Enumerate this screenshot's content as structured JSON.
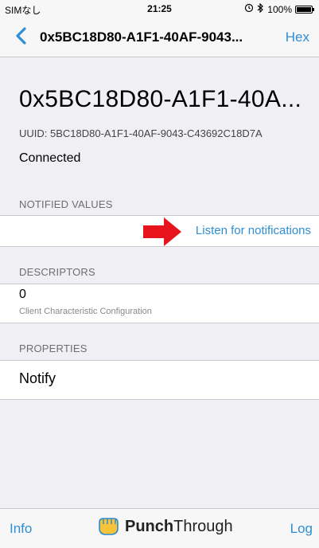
{
  "status": {
    "carrier": "SIMなし",
    "time": "21:25",
    "battery": "100%",
    "battery_level": 1.0
  },
  "nav": {
    "title": "0x5BC18D80-A1F1-40AF-9043...",
    "hex_label": "Hex",
    "back_icon": "chevron-left-icon"
  },
  "header": {
    "title": "0x5BC18D80-A1F1-40A...",
    "uuid": "UUID: 5BC18D80-A1F1-40AF-9043-C43692C18D7A",
    "state": "Connected"
  },
  "notified": {
    "section": "NOTIFIED VALUES",
    "listen_label": "Listen for notifications",
    "arrow_color": "#e8141b"
  },
  "descriptors": {
    "section": "DESCRIPTORS",
    "value": "0",
    "name": "Client Characteristic Configuration"
  },
  "properties": {
    "section": "PROPERTIES",
    "value": "Notify"
  },
  "tabbar": {
    "info": "Info",
    "log": "Log",
    "brand_bold": "Punch",
    "brand_regular": "Through",
    "brand_icon": "fist-logo-icon"
  },
  "colors": {
    "accent": "#2d8fd5",
    "background": "#efeff4"
  }
}
